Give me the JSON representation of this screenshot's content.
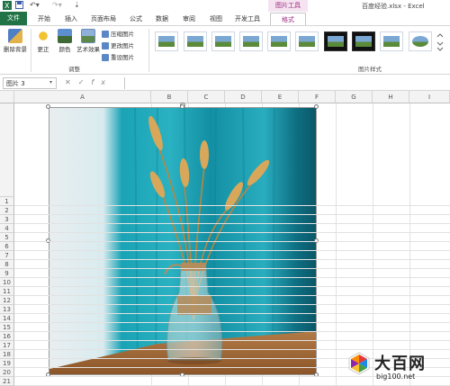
{
  "window": {
    "title": "百度经验.xlsx - Excel",
    "contextual_tab_group": "图片工具"
  },
  "tabs": [
    {
      "label": "文件"
    },
    {
      "label": "开始"
    },
    {
      "label": "插入"
    },
    {
      "label": "页面布局"
    },
    {
      "label": "公式"
    },
    {
      "label": "数据"
    },
    {
      "label": "审阅"
    },
    {
      "label": "视图"
    },
    {
      "label": "开发工具"
    },
    {
      "label": "格式"
    }
  ],
  "ribbon": {
    "remove_background": "删除背景",
    "corrections": "更正",
    "color": "颜色",
    "artistic_effects": "艺术效果",
    "compress_pictures": "压缩图片",
    "change_picture": "更改图片",
    "reset_picture": "重设图片",
    "adjust_group": "调整",
    "styles_group": "图片样式"
  },
  "formula_bar": {
    "name_box": "图片 3",
    "fx": "fx",
    "value": ""
  },
  "columns": [
    "A",
    "B",
    "C",
    "D",
    "E",
    "F",
    "G",
    "H",
    "I"
  ],
  "rows": [
    "1",
    "2",
    "3",
    "4",
    "5",
    "6",
    "7",
    "8",
    "9",
    "10",
    "11",
    "12",
    "13",
    "14",
    "15",
    "16",
    "17",
    "18",
    "19",
    "20",
    "21"
  ],
  "watermark": {
    "title": "大百网",
    "url": "big100.net"
  },
  "colors": {
    "excel_green": "#217346",
    "picture_tools_accent": "#9a2a7e",
    "curtain_teal": "#2aa6b8"
  }
}
